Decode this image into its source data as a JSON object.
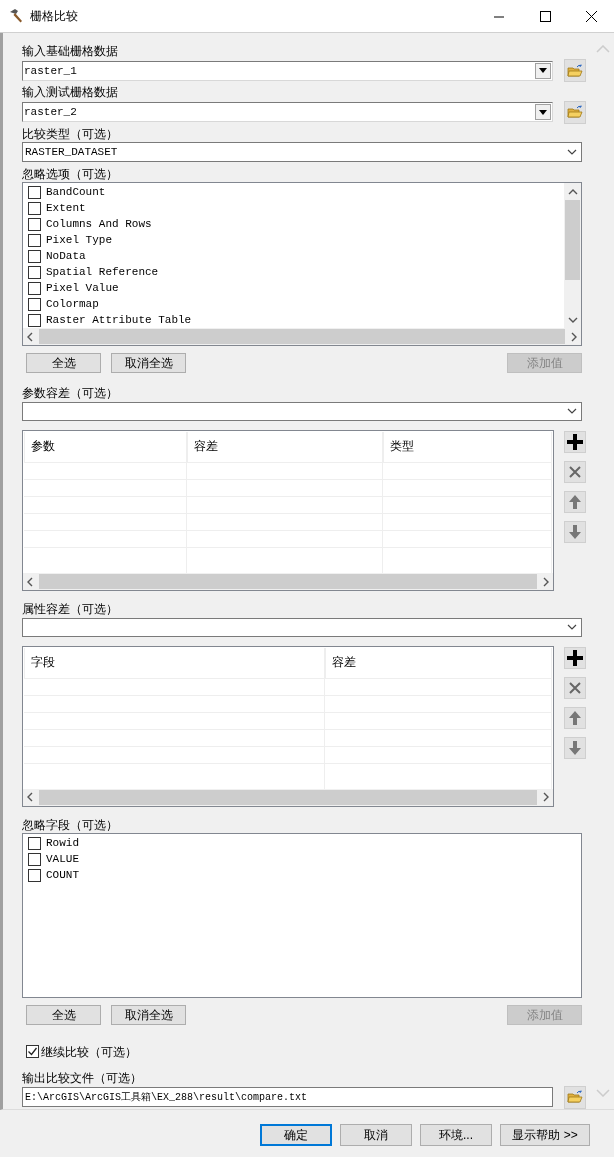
{
  "window": {
    "title": "栅格比较"
  },
  "fields": [
    {
      "kind": "dropdown_browse",
      "label": "输入基础栅格数据",
      "value": "raster_1"
    },
    {
      "kind": "dropdown_browse",
      "label": "输入测试栅格数据",
      "value": "raster_2"
    },
    {
      "kind": "combo",
      "label": "比较类型（可选）",
      "value": "RASTER_DATASET"
    },
    {
      "kind": "checklist",
      "label": "忽略选项（可选）",
      "items": [
        {
          "text": "BandCount",
          "checked": false
        },
        {
          "text": "Extent",
          "checked": false
        },
        {
          "text": "Columns And Rows",
          "checked": false
        },
        {
          "text": "Pixel Type",
          "checked": false
        },
        {
          "text": "NoData",
          "checked": false
        },
        {
          "text": "Spatial Reference",
          "checked": false
        },
        {
          "text": "Pixel Value",
          "checked": false
        },
        {
          "text": "Colormap",
          "checked": false
        },
        {
          "text": "Raster Attribute Table",
          "checked": false
        }
      ],
      "buttons": [
        {
          "text": "全选",
          "disabled": false
        },
        {
          "text": "取消全选",
          "disabled": false
        },
        {
          "text": "添加值",
          "disabled": true
        }
      ]
    },
    {
      "kind": "combo",
      "label": "参数容差（可选）"
    },
    {
      "kind": "table",
      "columns": [
        "参数",
        "容差",
        "类型"
      ]
    },
    {
      "kind": "combo",
      "label": "属性容差（可选）"
    },
    {
      "kind": "table",
      "columns": [
        "字段",
        "容差"
      ]
    },
    {
      "kind": "checklist",
      "label": "忽略字段（可选）",
      "items": [
        {
          "text": "Rowid",
          "checked": false
        },
        {
          "text": "VALUE",
          "checked": false
        },
        {
          "text": "COUNT",
          "checked": false
        }
      ],
      "buttons": [
        {
          "text": "全选",
          "disabled": false
        },
        {
          "text": "取消全选",
          "disabled": false
        },
        {
          "text": "添加值",
          "disabled": true
        }
      ]
    },
    {
      "kind": "checkbox",
      "label": "继续比较（可选）",
      "checked": true
    },
    {
      "kind": "file",
      "label": "输出比较文件（可选）",
      "value": "E:\\ArcGIS\\ArcGIS工具箱\\EX_288\\result\\compare.txt"
    }
  ],
  "footer_buttons": [
    {
      "text": "确定",
      "default": true
    },
    {
      "text": "取消",
      "default": false
    },
    {
      "text": "环境...",
      "default": false
    },
    {
      "text": "显示帮助 >>",
      "default": false
    }
  ]
}
